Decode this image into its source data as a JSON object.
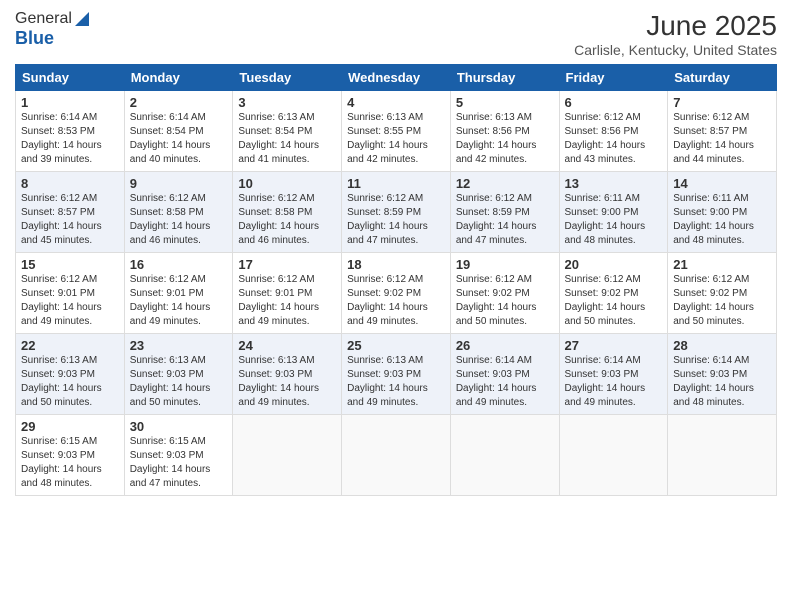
{
  "logo": {
    "line1": "General",
    "line2": "Blue"
  },
  "title": "June 2025",
  "subtitle": "Carlisle, Kentucky, United States",
  "days_header": [
    "Sunday",
    "Monday",
    "Tuesday",
    "Wednesday",
    "Thursday",
    "Friday",
    "Saturday"
  ],
  "weeks": [
    [
      {
        "day": "1",
        "sunrise": "6:14 AM",
        "sunset": "8:53 PM",
        "daylight": "14 hours and 39 minutes."
      },
      {
        "day": "2",
        "sunrise": "6:14 AM",
        "sunset": "8:54 PM",
        "daylight": "14 hours and 40 minutes."
      },
      {
        "day": "3",
        "sunrise": "6:13 AM",
        "sunset": "8:54 PM",
        "daylight": "14 hours and 41 minutes."
      },
      {
        "day": "4",
        "sunrise": "6:13 AM",
        "sunset": "8:55 PM",
        "daylight": "14 hours and 42 minutes."
      },
      {
        "day": "5",
        "sunrise": "6:13 AM",
        "sunset": "8:56 PM",
        "daylight": "14 hours and 42 minutes."
      },
      {
        "day": "6",
        "sunrise": "6:12 AM",
        "sunset": "8:56 PM",
        "daylight": "14 hours and 43 minutes."
      },
      {
        "day": "7",
        "sunrise": "6:12 AM",
        "sunset": "8:57 PM",
        "daylight": "14 hours and 44 minutes."
      }
    ],
    [
      {
        "day": "8",
        "sunrise": "6:12 AM",
        "sunset": "8:57 PM",
        "daylight": "14 hours and 45 minutes."
      },
      {
        "day": "9",
        "sunrise": "6:12 AM",
        "sunset": "8:58 PM",
        "daylight": "14 hours and 46 minutes."
      },
      {
        "day": "10",
        "sunrise": "6:12 AM",
        "sunset": "8:58 PM",
        "daylight": "14 hours and 46 minutes."
      },
      {
        "day": "11",
        "sunrise": "6:12 AM",
        "sunset": "8:59 PM",
        "daylight": "14 hours and 47 minutes."
      },
      {
        "day": "12",
        "sunrise": "6:12 AM",
        "sunset": "8:59 PM",
        "daylight": "14 hours and 47 minutes."
      },
      {
        "day": "13",
        "sunrise": "6:11 AM",
        "sunset": "9:00 PM",
        "daylight": "14 hours and 48 minutes."
      },
      {
        "day": "14",
        "sunrise": "6:11 AM",
        "sunset": "9:00 PM",
        "daylight": "14 hours and 48 minutes."
      }
    ],
    [
      {
        "day": "15",
        "sunrise": "6:12 AM",
        "sunset": "9:01 PM",
        "daylight": "14 hours and 49 minutes."
      },
      {
        "day": "16",
        "sunrise": "6:12 AM",
        "sunset": "9:01 PM",
        "daylight": "14 hours and 49 minutes."
      },
      {
        "day": "17",
        "sunrise": "6:12 AM",
        "sunset": "9:01 PM",
        "daylight": "14 hours and 49 minutes."
      },
      {
        "day": "18",
        "sunrise": "6:12 AM",
        "sunset": "9:02 PM",
        "daylight": "14 hours and 49 minutes."
      },
      {
        "day": "19",
        "sunrise": "6:12 AM",
        "sunset": "9:02 PM",
        "daylight": "14 hours and 50 minutes."
      },
      {
        "day": "20",
        "sunrise": "6:12 AM",
        "sunset": "9:02 PM",
        "daylight": "14 hours and 50 minutes."
      },
      {
        "day": "21",
        "sunrise": "6:12 AM",
        "sunset": "9:02 PM",
        "daylight": "14 hours and 50 minutes."
      }
    ],
    [
      {
        "day": "22",
        "sunrise": "6:13 AM",
        "sunset": "9:03 PM",
        "daylight": "14 hours and 50 minutes."
      },
      {
        "day": "23",
        "sunrise": "6:13 AM",
        "sunset": "9:03 PM",
        "daylight": "14 hours and 50 minutes."
      },
      {
        "day": "24",
        "sunrise": "6:13 AM",
        "sunset": "9:03 PM",
        "daylight": "14 hours and 49 minutes."
      },
      {
        "day": "25",
        "sunrise": "6:13 AM",
        "sunset": "9:03 PM",
        "daylight": "14 hours and 49 minutes."
      },
      {
        "day": "26",
        "sunrise": "6:14 AM",
        "sunset": "9:03 PM",
        "daylight": "14 hours and 49 minutes."
      },
      {
        "day": "27",
        "sunrise": "6:14 AM",
        "sunset": "9:03 PM",
        "daylight": "14 hours and 49 minutes."
      },
      {
        "day": "28",
        "sunrise": "6:14 AM",
        "sunset": "9:03 PM",
        "daylight": "14 hours and 48 minutes."
      }
    ],
    [
      {
        "day": "29",
        "sunrise": "6:15 AM",
        "sunset": "9:03 PM",
        "daylight": "14 hours and 48 minutes."
      },
      {
        "day": "30",
        "sunrise": "6:15 AM",
        "sunset": "9:03 PM",
        "daylight": "14 hours and 47 minutes."
      },
      null,
      null,
      null,
      null,
      null
    ]
  ]
}
